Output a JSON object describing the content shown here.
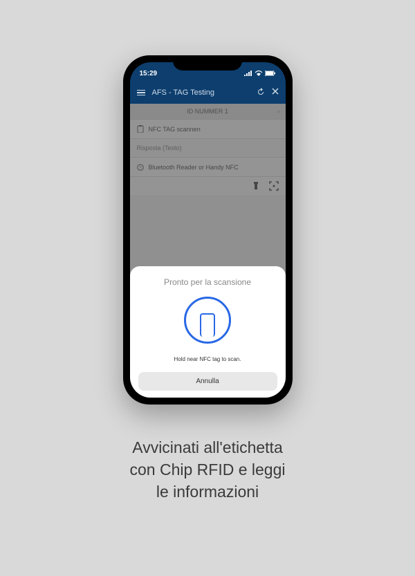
{
  "statusBar": {
    "time": "15:29"
  },
  "header": {
    "title": "AFS - TAG Testing"
  },
  "sectionHeader": {
    "label": "ID NUMMER 1"
  },
  "items": {
    "nfcScan": "NFC TAG scannen",
    "response": "Risposta (Testo)",
    "bluetooth": "Bluetooth Reader or Handy NFC"
  },
  "modal": {
    "title": "Pronto per la scansione",
    "instruction": "Hold near NFC tag to scan.",
    "cancelLabel": "Annulla"
  },
  "caption": {
    "line1": "Avvicinati all'etichetta",
    "line2": "con Chip RFID e leggi",
    "line3": "le informazioni"
  }
}
